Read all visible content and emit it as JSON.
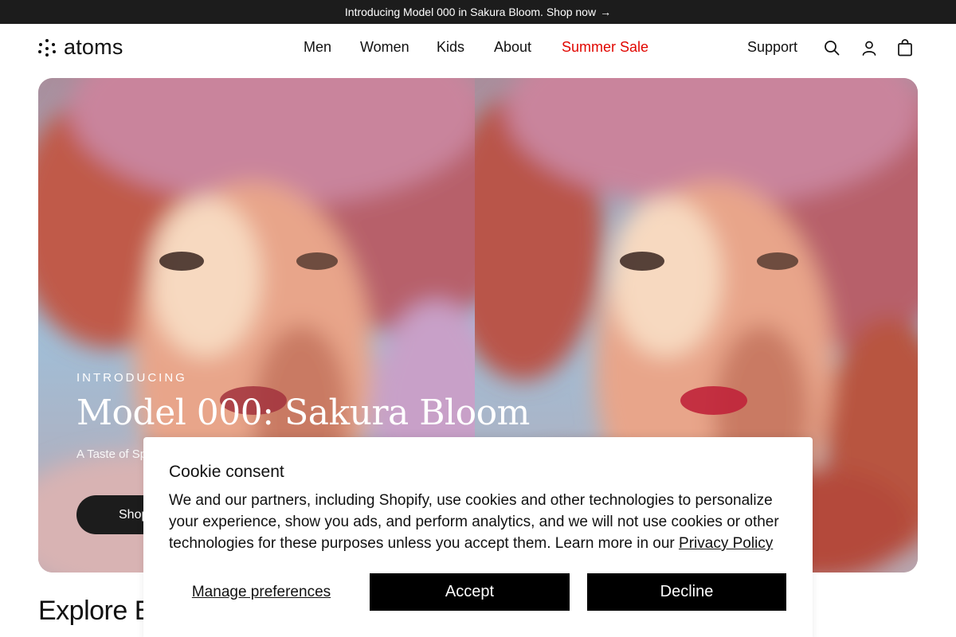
{
  "announcement": {
    "text": "Introducing Model 000 in Sakura Bloom. Shop now",
    "arrow": "→"
  },
  "brand": {
    "name": "atoms",
    "logo_icon": "dot-cluster-icon"
  },
  "nav": {
    "items": [
      {
        "label": "Men"
      },
      {
        "label": "Women"
      },
      {
        "label": "Kids"
      },
      {
        "label": "About"
      },
      {
        "label": "Summer Sale",
        "color": "#e10600"
      }
    ],
    "support_label": "Support",
    "icons": [
      "search-icon",
      "account-icon",
      "cart-bag-icon"
    ]
  },
  "hero": {
    "eyebrow": "INTRODUCING",
    "title": "Model 000: Sakura Bloom",
    "subtitle": "A Taste of Sp",
    "cta_label": "Shop"
  },
  "section": {
    "title": "Explore Ev"
  },
  "cookie": {
    "title": "Cookie consent",
    "body": "We and our partners, including Shopify, use cookies and other technologies to personalize your experience, show you ads, and perform analytics, and we will not use cookies or other technologies for these purposes unless you accept them. Learn more in our ",
    "link_label": "Privacy Policy",
    "manage_label": "Manage preferences",
    "accept_label": "Accept",
    "decline_label": "Decline"
  },
  "colors": {
    "announcement_bg": "#1c1c1c",
    "sale": "#e10600",
    "button_bg": "#000000"
  }
}
